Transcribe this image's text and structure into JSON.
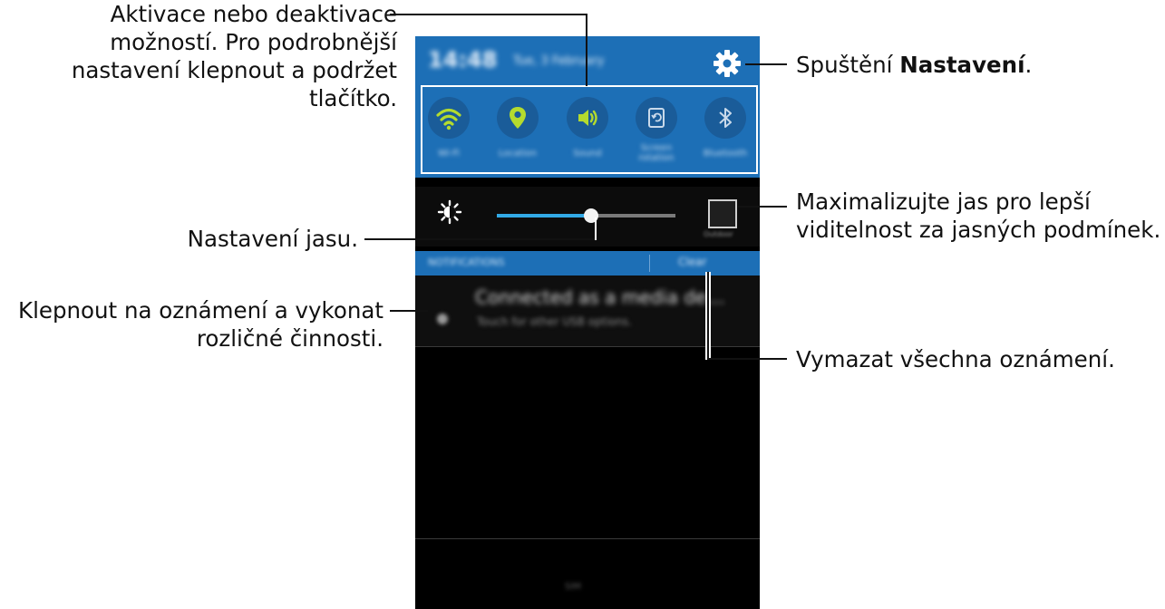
{
  "phone": {
    "status_bar": {
      "time": "14:48",
      "date": "Tue, 3 February"
    },
    "quick_settings": [
      {
        "icon": "wifi-icon",
        "label": "Wi-Fi",
        "active": true
      },
      {
        "icon": "location-icon",
        "label": "Location",
        "active": true
      },
      {
        "icon": "sound-icon",
        "label": "Sound",
        "active": true
      },
      {
        "icon": "screen-rotation-icon",
        "label": "Screen rotation",
        "active": false
      },
      {
        "icon": "bluetooth-icon",
        "label": "Bluetooth",
        "active": false
      }
    ],
    "brightness": {
      "level_percent": 53,
      "outdoor_label": "Outdoor"
    },
    "notifications": {
      "header": "NOTIFICATIONS",
      "clear_label": "Clear",
      "items": [
        {
          "title": "Connected as a media de…",
          "subtitle": "Touch for other USB options."
        }
      ]
    },
    "bottom_label": "SIM"
  },
  "callouts": {
    "quick_settings_line1": "Aktivace nebo deaktivace",
    "quick_settings_line2": "možností. Pro podrobnější",
    "quick_settings_line3": "nastavení klepnout a podržet",
    "quick_settings_line4": "tlačítko.",
    "settings_prefix": "Spuštění ",
    "settings_bold": "Nastavení",
    "settings_suffix": ".",
    "brightness": "Nastavení jasu.",
    "outdoor_line1": "Maximalizujte jas pro lepší",
    "outdoor_line2": "viditelnost za jasných podmínek.",
    "notification_line1": "Klepnout na oznámení a vykonat",
    "notification_line2": "rozličné činnosti.",
    "clear": "Vymazat všechna oznámení."
  },
  "colors": {
    "panel_blue": "#1d6fb6",
    "tile_blue": "#1a5c99",
    "active_green": "#b4db2e",
    "slider_blue": "#32a9e6"
  }
}
